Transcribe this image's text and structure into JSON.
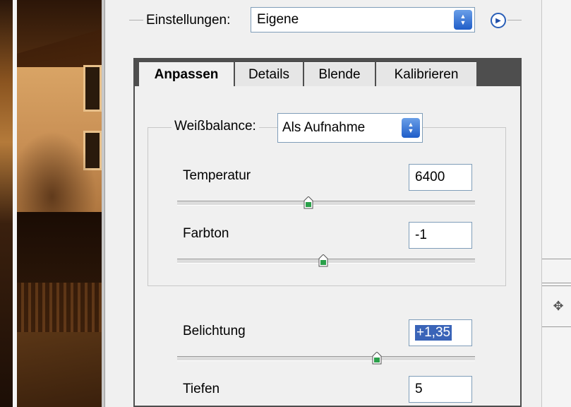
{
  "settings": {
    "label": "Einstellungen:",
    "value": "Eigene"
  },
  "tabs": [
    {
      "label": "Anpassen",
      "active": true
    },
    {
      "label": "Details",
      "active": false
    },
    {
      "label": "Blende",
      "active": false
    },
    {
      "label": "Kalibrieren",
      "active": false
    }
  ],
  "white_balance": {
    "label": "Weißbalance:",
    "value": "Als Aufnahme"
  },
  "controls": {
    "temperature": {
      "label": "Temperatur",
      "value": "6400",
      "slider": 0.44
    },
    "tint": {
      "label": "Farbton",
      "value": "-1",
      "slider": 0.49
    },
    "exposure": {
      "label": "Belichtung",
      "value": "+1,35",
      "slider": 0.67
    },
    "shadows": {
      "label": "Tiefen",
      "value": "5"
    }
  },
  "colors": {
    "selection": "#3a64b8",
    "tab_bar": "#4e4e4e",
    "spin_button": "#1f5dc8",
    "thumb": "#2aa04a"
  },
  "icons": {
    "flyout": "circle-arrow-right-icon",
    "spin": "up-down-arrows-icon",
    "move": "move-cross-icon"
  }
}
